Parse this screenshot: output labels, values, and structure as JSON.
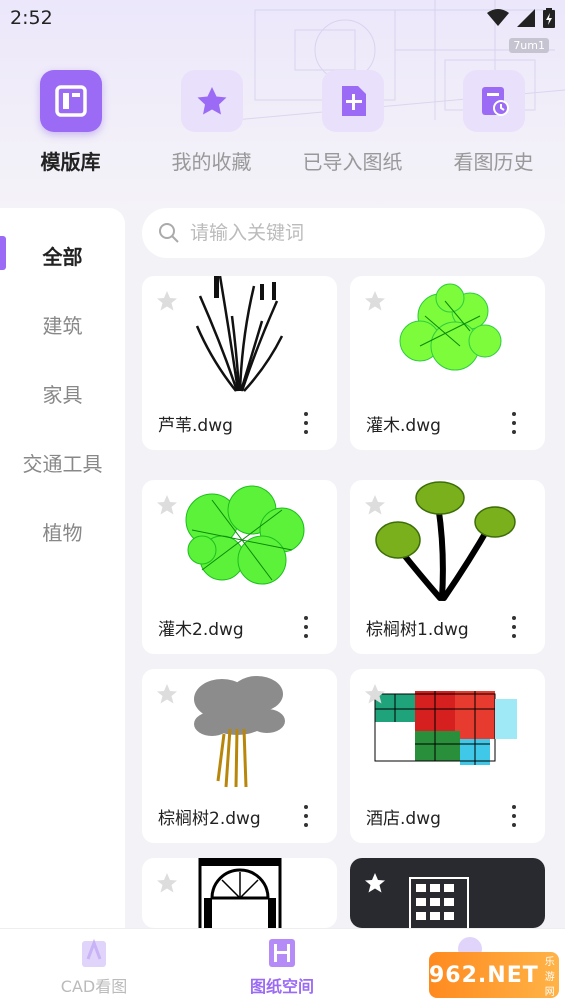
{
  "status_bar": {
    "time": "2:52",
    "tag": "7um1"
  },
  "top_tabs": [
    {
      "label": "模版库",
      "icon": "template-icon",
      "active": true
    },
    {
      "label": "我的收藏",
      "icon": "star-icon",
      "active": false
    },
    {
      "label": "已导入图纸",
      "icon": "import-file-icon",
      "active": false
    },
    {
      "label": "看图历史",
      "icon": "history-icon",
      "active": false
    }
  ],
  "sidebar": {
    "items": [
      {
        "label": "全部",
        "active": true
      },
      {
        "label": "建筑",
        "active": false
      },
      {
        "label": "家具",
        "active": false
      },
      {
        "label": "交通工具",
        "active": false
      },
      {
        "label": "植物",
        "active": false
      }
    ]
  },
  "search": {
    "placeholder": "请输入关键词"
  },
  "cards": [
    {
      "name": "芦苇.dwg"
    },
    {
      "name": "灌木.dwg"
    },
    {
      "name": "灌木2.dwg"
    },
    {
      "name": "棕榈树1.dwg"
    },
    {
      "name": "棕榈树2.dwg"
    },
    {
      "name": "酒店.dwg"
    },
    {
      "name": ""
    },
    {
      "name": ""
    }
  ],
  "bottom_nav": [
    {
      "label": "CAD看图",
      "active": false
    },
    {
      "label": "图纸空间",
      "active": true
    },
    {
      "label": "",
      "active": false
    }
  ],
  "watermark": {
    "main": "962.NET",
    "sub": "乐游网"
  },
  "colors": {
    "accent": "#9b6bf5",
    "accent_light": "#e9e0fb",
    "background": "#f3f2f7"
  }
}
